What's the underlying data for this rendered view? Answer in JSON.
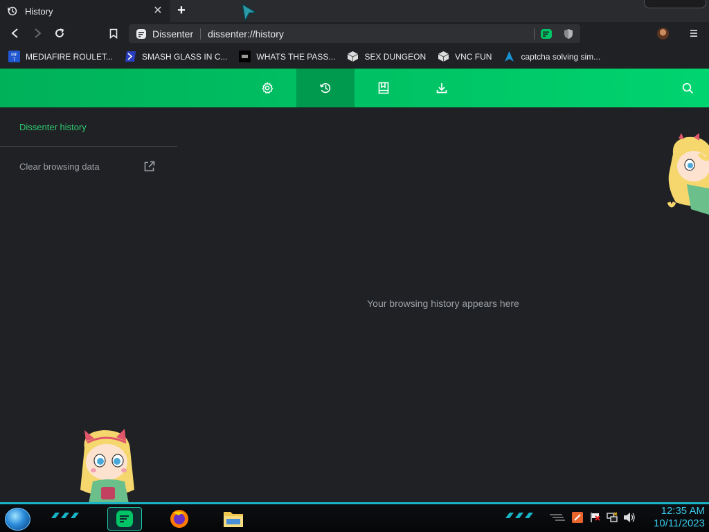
{
  "tab": {
    "title": "History",
    "icon": "history-icon",
    "close_glyph": "✕"
  },
  "toolbar": {
    "back_icon": "back-arrow-icon",
    "forward_icon": "forward-arrow-icon",
    "reload_icon": "reload-icon",
    "bookmark_icon": "bookmark-icon",
    "menu_icon": "hamburger-menu-icon"
  },
  "omnibox": {
    "site_name": "Dissenter",
    "url": "dissenter://history"
  },
  "bookmarks": [
    {
      "label": "MEDIAFIRE ROULET...",
      "icon": "mediafire-icon"
    },
    {
      "label": "SMASH GLASS IN C...",
      "icon": "powershell-icon"
    },
    {
      "label": "WHATS THE PASS...",
      "icon": "terminal-icon"
    },
    {
      "label": "SEX DUNGEON",
      "icon": "dice-icon"
    },
    {
      "label": "VNC FUN",
      "icon": "dice-icon"
    },
    {
      "label": "captcha solving sim...",
      "icon": "arch-icon"
    }
  ],
  "header": {
    "nav": [
      {
        "name": "settings",
        "icon": "gear-icon",
        "active": false
      },
      {
        "name": "history",
        "icon": "history-icon",
        "active": true
      },
      {
        "name": "bookmarks",
        "icon": "bookmarks-icon",
        "active": false
      },
      {
        "name": "downloads",
        "icon": "download-icon",
        "active": false
      }
    ],
    "search_icon": "search-icon"
  },
  "sidebar": {
    "title": "Dissenter history",
    "clear_label": "Clear browsing data"
  },
  "main": {
    "empty_message": "Your browsing history appears here"
  },
  "taskbar": {
    "time": "12:35 AM",
    "date": "10/11/2023"
  },
  "colors": {
    "accent_green": "#00c465",
    "sidebar_title": "#2ecc71",
    "page_bg": "#202124",
    "clock": "#39c8e8"
  }
}
